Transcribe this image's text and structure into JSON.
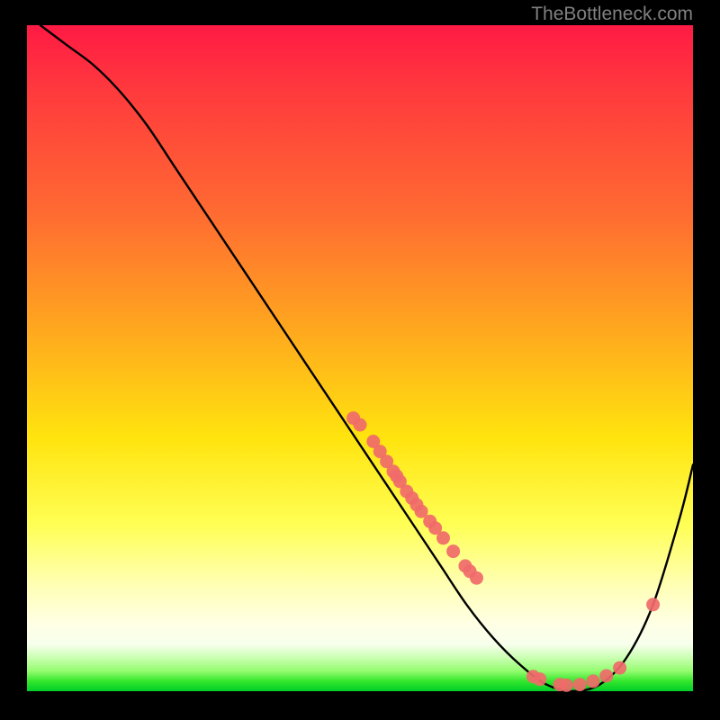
{
  "attribution": "TheBottleneck.com",
  "chart_data": {
    "type": "line",
    "title": "",
    "xlabel": "",
    "ylabel": "",
    "xlim": [
      0,
      100
    ],
    "ylim": [
      0,
      100
    ],
    "grid": false,
    "legend": false,
    "background_gradient": [
      "#ff1a44",
      "#ff6a32",
      "#ffe40e",
      "#ffffe6",
      "#00cf2a"
    ],
    "series": [
      {
        "name": "bottleneck-curve",
        "color": "#000000",
        "x": [
          2,
          6,
          10,
          14,
          18,
          22,
          26,
          30,
          34,
          38,
          42,
          46,
          50,
          54,
          58,
          62,
          66,
          70,
          74,
          78,
          82,
          86,
          90,
          94,
          98,
          100
        ],
        "y": [
          100,
          97,
          94,
          90,
          85,
          79,
          73,
          67,
          61,
          55,
          49,
          43,
          37,
          31,
          25,
          19,
          13,
          8,
          4,
          1,
          0,
          1,
          5,
          13,
          26,
          34
        ]
      }
    ],
    "scatter": {
      "name": "marker-dots",
      "color": "#f06a6a",
      "points": [
        {
          "x": 49,
          "y": 41
        },
        {
          "x": 50,
          "y": 40
        },
        {
          "x": 52,
          "y": 37.5
        },
        {
          "x": 53,
          "y": 36
        },
        {
          "x": 54,
          "y": 34.5
        },
        {
          "x": 55,
          "y": 33
        },
        {
          "x": 55.5,
          "y": 32.3
        },
        {
          "x": 56,
          "y": 31.5
        },
        {
          "x": 57,
          "y": 30
        },
        {
          "x": 57.8,
          "y": 29
        },
        {
          "x": 58.5,
          "y": 28
        },
        {
          "x": 59.2,
          "y": 27
        },
        {
          "x": 60.5,
          "y": 25.5
        },
        {
          "x": 61.3,
          "y": 24.5
        },
        {
          "x": 62.5,
          "y": 23
        },
        {
          "x": 64,
          "y": 21
        },
        {
          "x": 65.8,
          "y": 18.8
        },
        {
          "x": 66.5,
          "y": 18
        },
        {
          "x": 67.5,
          "y": 17
        },
        {
          "x": 76,
          "y": 2.2
        },
        {
          "x": 77,
          "y": 1.8
        },
        {
          "x": 80,
          "y": 1
        },
        {
          "x": 81,
          "y": 0.9
        },
        {
          "x": 83,
          "y": 1
        },
        {
          "x": 85,
          "y": 1.5
        },
        {
          "x": 87,
          "y": 2.3
        },
        {
          "x": 89,
          "y": 3.5
        },
        {
          "x": 94,
          "y": 13
        }
      ]
    }
  }
}
